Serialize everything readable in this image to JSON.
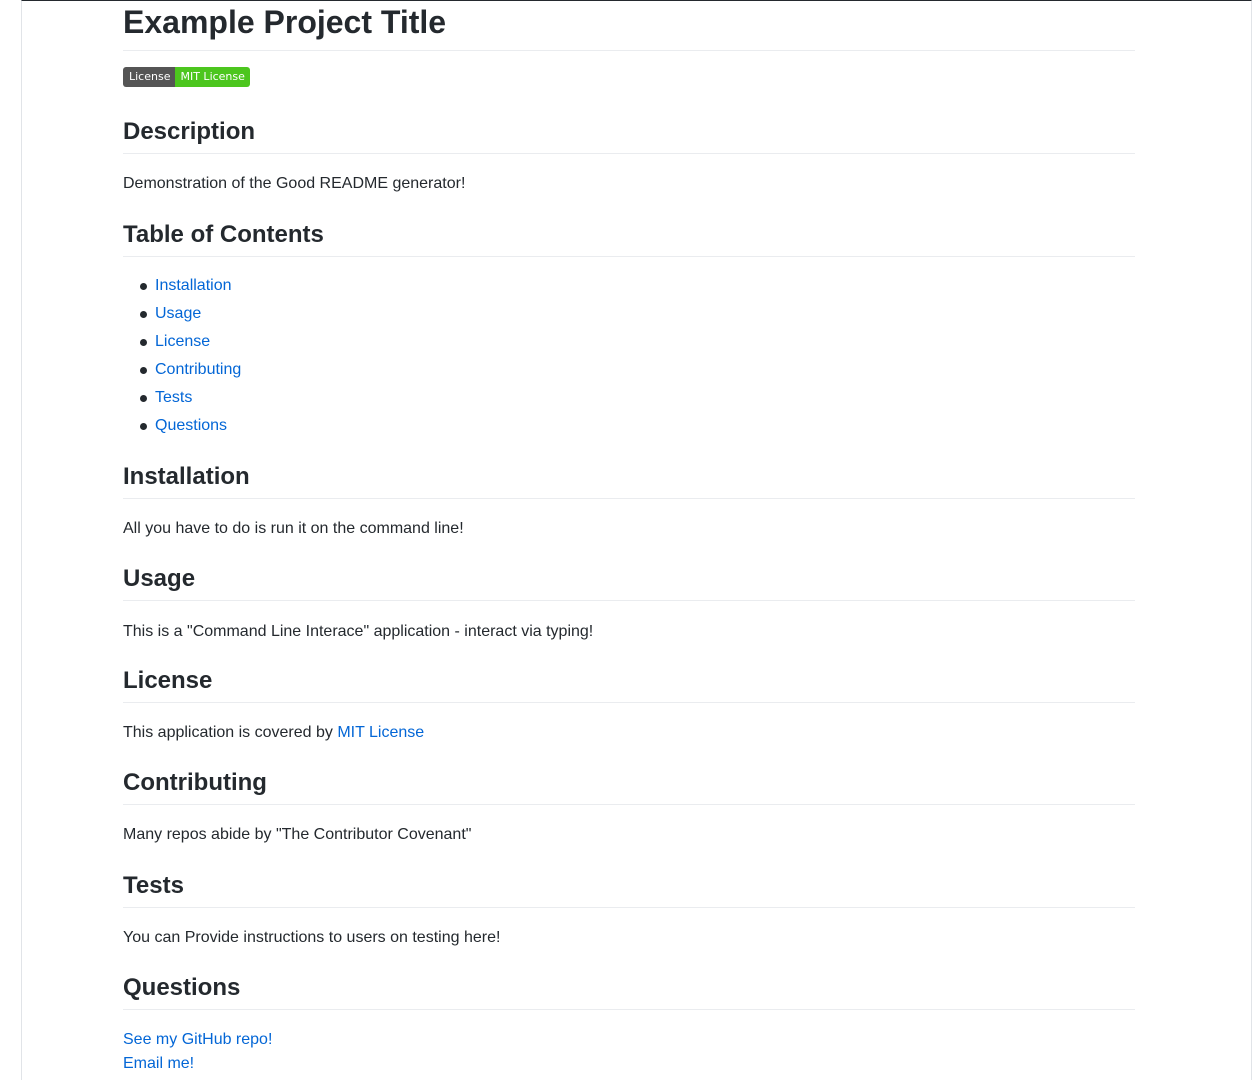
{
  "title": "Example Project Title",
  "badge": {
    "label": "License",
    "value": "MIT License",
    "color": "#4cc61e"
  },
  "description": {
    "heading": "Description",
    "text": "Demonstration of the Good README generator!"
  },
  "toc": {
    "heading": "Table of Contents",
    "items": [
      "Installation",
      "Usage",
      "License",
      "Contributing",
      "Tests",
      "Questions"
    ]
  },
  "installation": {
    "heading": "Installation",
    "text": "All you have to do is run it on the command line!"
  },
  "usage": {
    "heading": "Usage",
    "text": "This is a \"Command Line Interace\" application - interact via typing!"
  },
  "license": {
    "heading": "License",
    "text_prefix": "This application is covered by ",
    "link": "MIT License"
  },
  "contributing": {
    "heading": "Contributing",
    "text": "Many repos abide by \"The Contributor Covenant\""
  },
  "tests": {
    "heading": "Tests",
    "text": "You can Provide instructions to users on testing here!"
  },
  "questions": {
    "heading": "Questions",
    "github_link": "See my GitHub repo!",
    "email_link": "Email me!"
  },
  "colors": {
    "link": "#0366d6",
    "text": "#24292e",
    "rule": "#eaecef"
  }
}
